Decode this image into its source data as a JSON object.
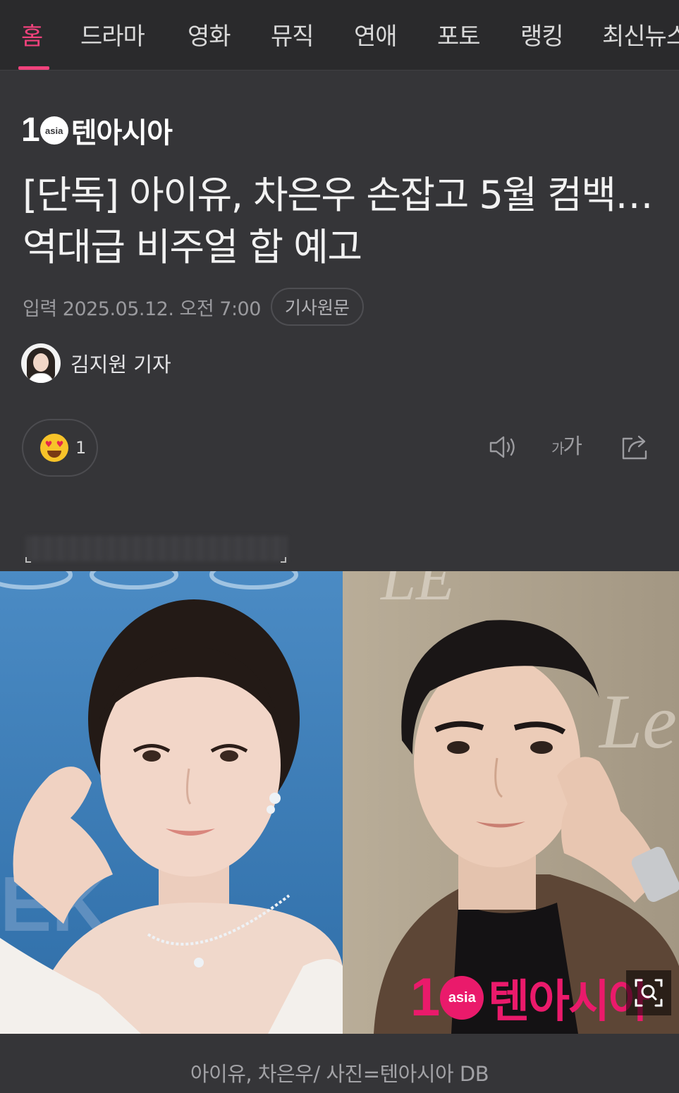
{
  "nav": {
    "tabs": [
      "홈",
      "드라마",
      "영화",
      "뮤직",
      "연애",
      "포토",
      "랭킹",
      "최신뉴스"
    ],
    "active_index": 0
  },
  "brand": {
    "logo_mark": "1",
    "logo_circle": "asia",
    "logo_name": "텐아시아"
  },
  "article": {
    "headline": "[단독] 아이유, 차은우 손잡고 5월 컴백…역대급 비주얼 합 예고",
    "date": "입력 2025.05.12. 오전 7:00",
    "source_button": "기사원문",
    "author": "김지원 기자",
    "reaction": {
      "emoji": "heart-eyes",
      "count": "1"
    },
    "tools": {
      "text_size_label_small": "가",
      "text_size_label_large": "가"
    }
  },
  "photo": {
    "watermark_mark": "1",
    "watermark_circle": "asia",
    "watermark_name": "텐아시아",
    "caption": "아이유, 차은우/ 사진=텐아시아 DB"
  },
  "colors": {
    "accent": "#f0427c",
    "background": "#353538"
  }
}
